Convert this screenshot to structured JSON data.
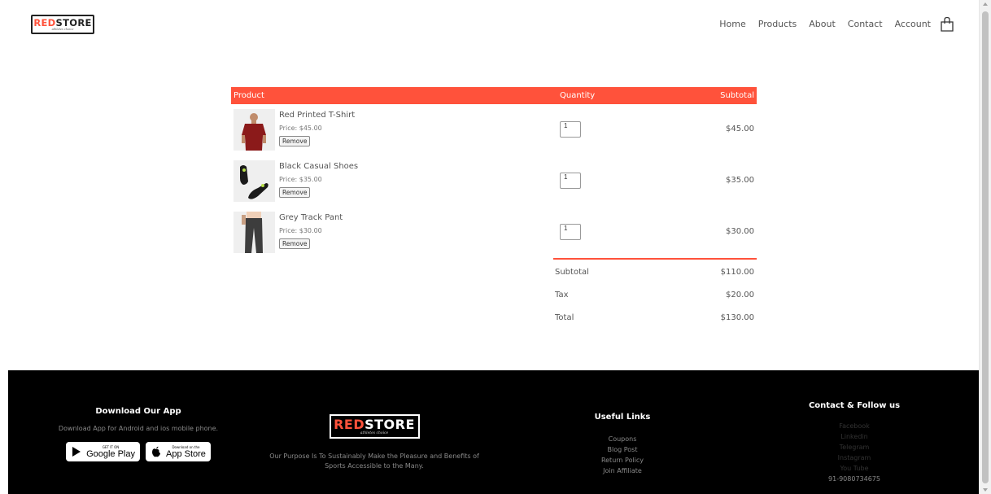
{
  "brand": {
    "logo_red": "RED",
    "logo_dark": "STORE",
    "tagline": "athletes choice"
  },
  "nav": [
    "Home",
    "Products",
    "About",
    "Contact",
    "Account"
  ],
  "cart": {
    "headers": {
      "product": "Product",
      "quantity": "Quantity",
      "subtotal": "Subtotal"
    },
    "items": [
      {
        "name": "Red Printed T-Shirt",
        "price": "Price: $45.00",
        "remove": "Remove",
        "qty": "1",
        "subtotal": "$45.00",
        "thumb": "tshirt-icon"
      },
      {
        "name": "Black Casual Shoes",
        "price": "Price: $35.00",
        "remove": "Remove",
        "qty": "1",
        "subtotal": "$35.00",
        "thumb": "shoe-icon"
      },
      {
        "name": "Grey Track Pant",
        "price": "Price: $30.00",
        "remove": "Remove",
        "qty": "1",
        "subtotal": "$30.00",
        "thumb": "pants-icon"
      }
    ],
    "totals": [
      {
        "label": "Subtotal",
        "value": "$110.00"
      },
      {
        "label": "Tax",
        "value": "$20.00"
      },
      {
        "label": "Total",
        "value": "$130.00"
      }
    ]
  },
  "footer": {
    "app": {
      "title": "Download Our App",
      "desc": "Download App for Android and ios mobile phone.",
      "google_small": "GET IT ON",
      "google_big": "Google Play",
      "apple_small": "Download on the",
      "apple_big": "App Store"
    },
    "about": {
      "logo_red": "RED",
      "logo_light": "STORE",
      "tagline": "athletes choice",
      "text": "Our Purpose Is To Sustainably Make the Pleasure and Benefits of Sports Accessible to the Many."
    },
    "links": {
      "title": "Useful Links",
      "items": [
        "Coupons",
        "Blog Post",
        "Return Policy",
        "Join Affiliate"
      ]
    },
    "contact": {
      "title": "Contact & Follow us",
      "items": [
        "Facebook",
        "Linkedin",
        "Telegram",
        "Instagram",
        "You Tube"
      ],
      "phone": "91-9080734675"
    }
  },
  "colors": {
    "accent": "#ff523b",
    "footer_bg": "#000000"
  }
}
